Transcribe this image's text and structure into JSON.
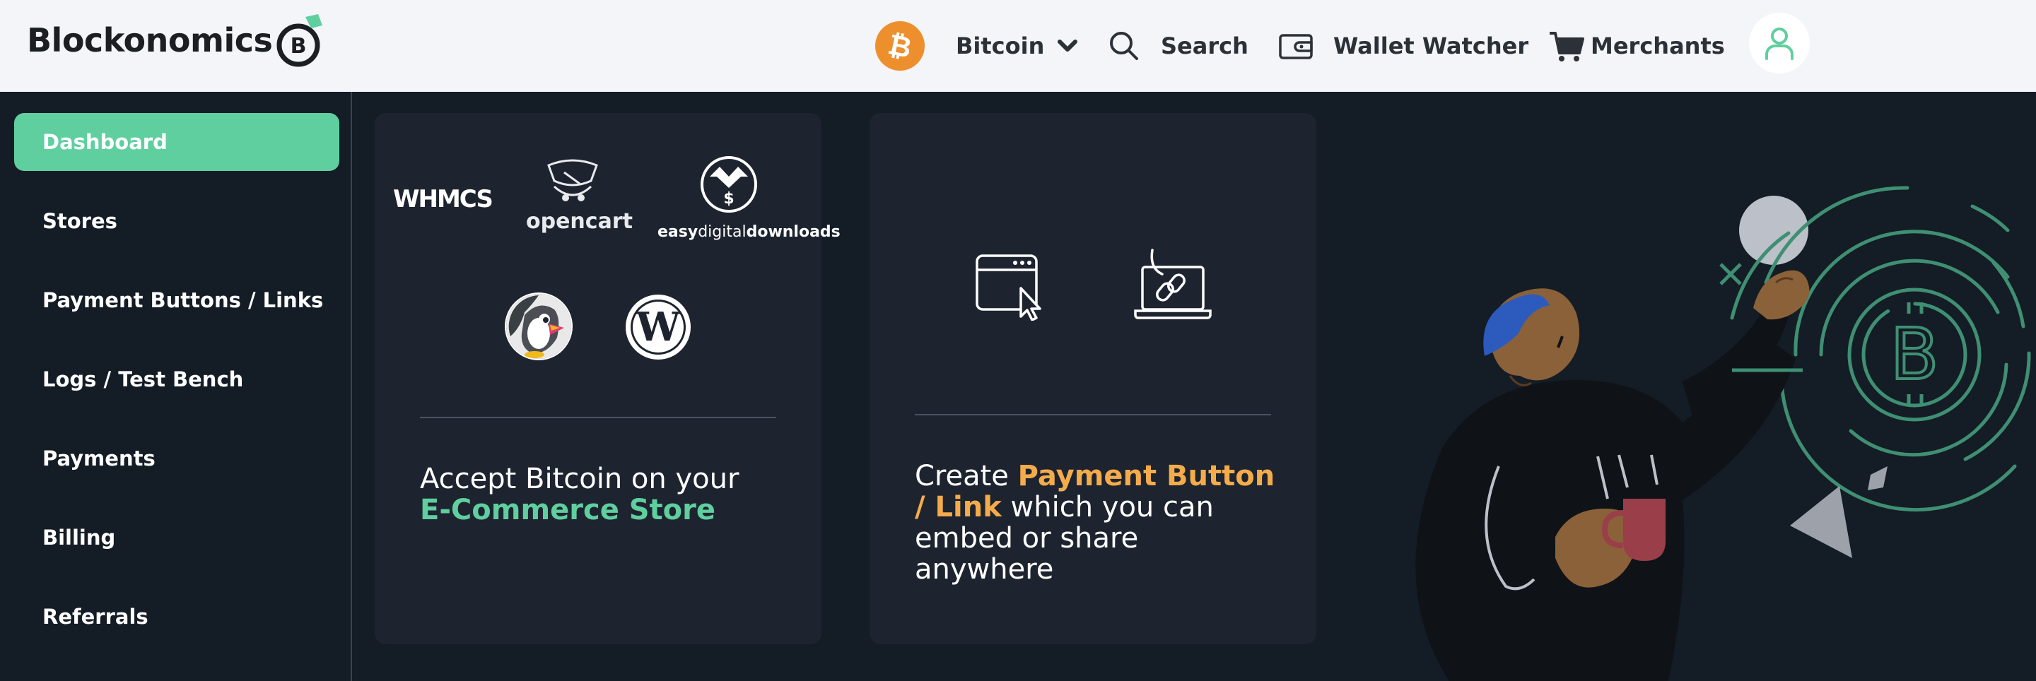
{
  "header": {
    "brand": "Blockonomics",
    "brand_mark": "B",
    "currency": "Bitcoin",
    "search": "Search",
    "wallet_watcher": "Wallet Watcher",
    "merchants": "Merchants"
  },
  "sidebar": {
    "items": [
      {
        "label": "Dashboard",
        "active": true
      },
      {
        "label": "Stores"
      },
      {
        "label": "Payment Buttons / Links"
      },
      {
        "label": "Logs / Test Bench"
      },
      {
        "label": "Payments"
      },
      {
        "label": "Billing"
      },
      {
        "label": "Referrals"
      }
    ]
  },
  "ecommerce_card": {
    "logos": {
      "whmcs": "WHMCS",
      "opencart": "opencart",
      "edd_easy": "easy",
      "edd_digital": "digital",
      "edd_downloads": "downloads",
      "prestashop": "PrestaShop",
      "wordpress": "WordPress"
    },
    "text_line1": "Accept Bitcoin on your",
    "text_highlight": "E-Commerce Store"
  },
  "payment_card": {
    "text_prefix": "Create ",
    "text_highlight_1": "Payment Button",
    "text_highlight_2": "/ Link",
    "text_line2_rest": " which you can",
    "text_line3": "embed or share",
    "text_line4": "anywhere"
  },
  "colors": {
    "accent_green": "#5fcf9f",
    "accent_orange": "#f4ac4b",
    "bitcoin_orange": "#ee8f2e",
    "background": "#141c26",
    "card": "#1e242f"
  }
}
